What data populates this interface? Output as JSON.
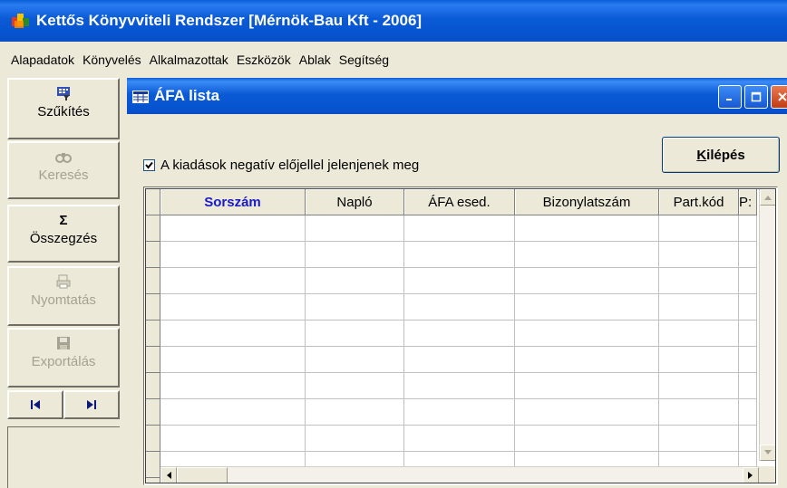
{
  "app": {
    "title": "Kettős Könyvviteli Rendszer [Mérnök-Bau Kft - 2006]"
  },
  "menu": [
    "Alapadatok",
    "Könyvelés",
    "Alkalmazottak",
    "Eszközök",
    "Ablak",
    "Segítség"
  ],
  "toolbar": {
    "narrow_label": "Szűkítés",
    "search_label": "Keresés",
    "sum_label": "Összegzés",
    "sum_icon_glyph": "Σ",
    "print_label": "Nyomtatás",
    "export_label": "Exportálás"
  },
  "window": {
    "title": "ÁFA lista",
    "exit_label": "Kilépés",
    "exit_accesskey": "K",
    "exit_rest": "ilépés",
    "checkbox_label": "A kiadások negatív előjellel jelenjenek meg",
    "checkbox_checked": true
  },
  "grid": {
    "columns": [
      "Sorszám",
      "Napló",
      "ÁFA esed.",
      "Bizonylatszám",
      "Part.kód",
      "P:"
    ]
  }
}
